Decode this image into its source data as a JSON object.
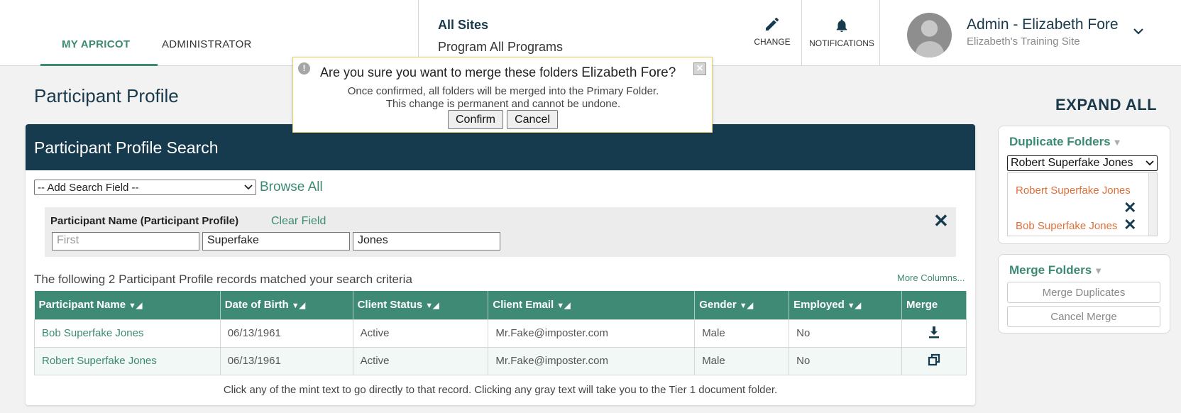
{
  "nav": {
    "tab_my_apricot": "MY APRICOT",
    "tab_administrator": "ADMINISTRATOR"
  },
  "site": {
    "title": "All Sites",
    "program": "Program All Programs"
  },
  "header_buttons": {
    "change": "CHANGE",
    "notifications": "NOTIFICATIONS"
  },
  "user": {
    "name": "Admin - Elizabeth Fore",
    "site": "Elizabeth's Training Site"
  },
  "page": {
    "title": "Participant Profile",
    "expand_all": "EXPAND ALL"
  },
  "search": {
    "header": "Participant Profile Search",
    "add_field": "-- Add Search Field --",
    "browse_all": "Browse All",
    "field_label": "Participant Name (Participant Profile)",
    "clear_field": "Clear Field",
    "first_placeholder": "First",
    "middle_value": "Superfake",
    "last_value": "Jones",
    "result_text": "The following 2 Participant Profile records matched your search criteria",
    "more_columns": "More Columns..."
  },
  "table": {
    "headers": [
      "Participant Name",
      "Date of Birth",
      "Client Status",
      "Client Email",
      "Gender",
      "Employed",
      "Merge"
    ],
    "rows": [
      {
        "name": "Bob Superfake Jones",
        "dob": "06/13/1961",
        "status": "Active",
        "email": "Mr.Fake@imposter.com",
        "gender": "Male",
        "employed": "No",
        "merge_icon": "download-icon"
      },
      {
        "name": "Robert Superfake Jones",
        "dob": "06/13/1961",
        "status": "Active",
        "email": "Mr.Fake@imposter.com",
        "gender": "Male",
        "employed": "No",
        "merge_icon": "copy-icon"
      }
    ],
    "footnote": "Click any of the mint text to go directly to that record. Clicking any gray text will take you to the Tier 1 document folder."
  },
  "duplicates": {
    "title": "Duplicate Folders",
    "selected": "Robert Superfake Jones",
    "items": [
      "Robert Superfake Jones",
      "Bob Superfake Jones"
    ]
  },
  "merge": {
    "title": "Merge Folders",
    "merge_button": "Merge Duplicates",
    "cancel_button": "Cancel Merge"
  },
  "dialog": {
    "question": "Are you sure you want to merge these folders",
    "name": "Elizabeth Fore?",
    "line1": "Once confirmed, all folders will be merged into the Primary Folder.",
    "line2": "This change is permanent and cannot be undone.",
    "confirm": "Confirm",
    "cancel": "Cancel"
  },
  "colors": {
    "brand_dark": "#163b4f",
    "mint": "#3d8a74",
    "orange": "#e0703a"
  }
}
